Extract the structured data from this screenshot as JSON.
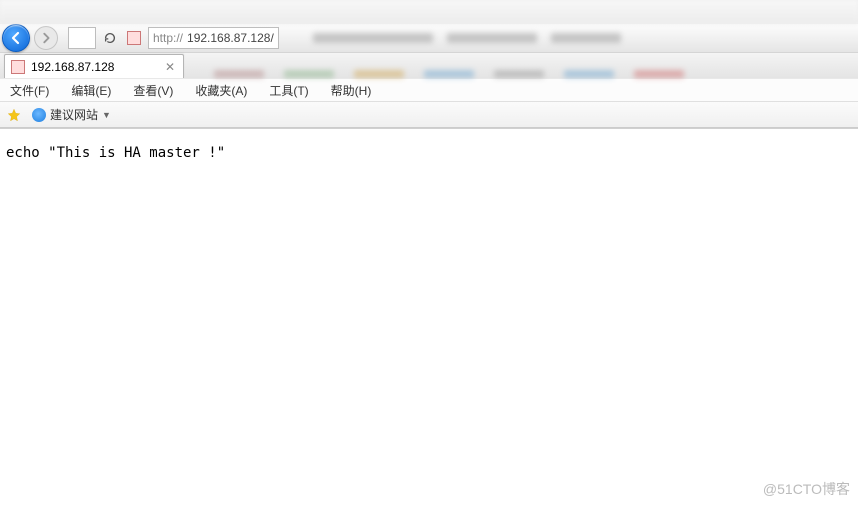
{
  "title_bar": "       ",
  "url": {
    "protocol": "http://",
    "host": "192.168.87.128/"
  },
  "tab": {
    "title": "192.168.87.128"
  },
  "menu": {
    "file": "文件(F)",
    "edit": "编辑(E)",
    "view": "查看(V)",
    "favorites": "收藏夹(A)",
    "tools": "工具(T)",
    "help": "帮助(H)"
  },
  "fav": {
    "suggested": "建议网站"
  },
  "page": {
    "body": "echo \"This is HA master !\""
  },
  "watermark": "@51CTO博客"
}
